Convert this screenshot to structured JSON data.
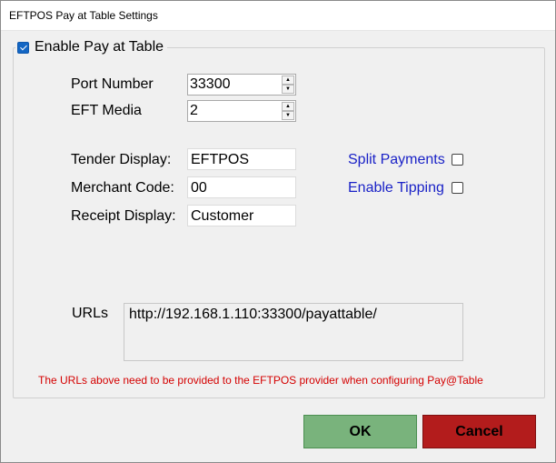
{
  "window": {
    "title": "EFTPOS Pay at Table Settings"
  },
  "group": {
    "enable_label": "Enable Pay at Table",
    "enable_checked": true
  },
  "port": {
    "label": "Port Number",
    "value": "33300"
  },
  "eft_media": {
    "label": "EFT Media",
    "value": "2"
  },
  "tender": {
    "label": "Tender Display:",
    "value": "EFTPOS"
  },
  "merchant": {
    "label": "Merchant Code:",
    "value": "00"
  },
  "receipt": {
    "label": "Receipt Display:",
    "value": "Customer"
  },
  "split_payments": {
    "label": "Split Payments",
    "checked": false
  },
  "enable_tipping": {
    "label": "Enable Tipping",
    "checked": false
  },
  "urls": {
    "label": "URLs",
    "value": "http://192.168.1.110:33300/payattable/"
  },
  "note": "The URLs above need to be provided to the EFTPOS provider when configuring Pay@Table",
  "buttons": {
    "ok": "OK",
    "cancel": "Cancel"
  },
  "colors": {
    "ok_bg": "#79b37c",
    "cancel_bg": "#b31c1c",
    "link_blue": "#1a22c7",
    "note_red": "#d40000"
  }
}
